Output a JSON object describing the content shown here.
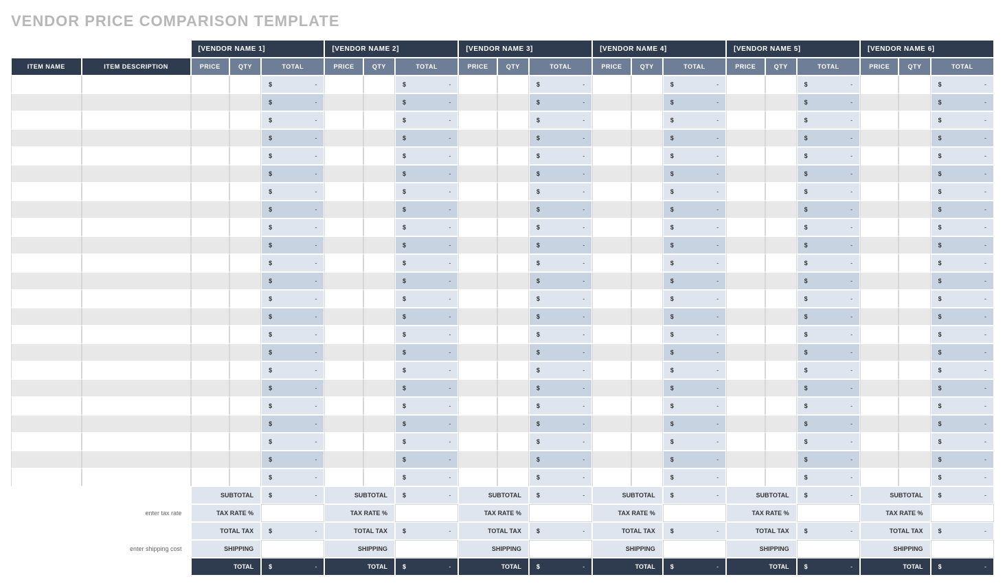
{
  "title": "VENDOR PRICE COMPARISON TEMPLATE",
  "headers": {
    "item_name": "ITEM NAME",
    "item_description": "ITEM DESCRIPTION",
    "price": "PRICE",
    "qty": "QTY",
    "total": "TOTAL"
  },
  "vendors": [
    "[VENDOR NAME 1]",
    "[VENDOR NAME 2]",
    "[VENDOR NAME 3]",
    "[VENDOR NAME 4]",
    "[VENDOR NAME 5]",
    "[VENDOR NAME 6]"
  ],
  "row_count": 23,
  "cell_currency": "$",
  "cell_dash": "-",
  "summary": {
    "subtotal_label": "SUBTOTAL",
    "tax_rate_hint": "enter tax rate",
    "tax_rate_label": "TAX RATE %",
    "total_tax_label": "TOTAL TAX",
    "shipping_hint": "enter shipping cost",
    "shipping_label": "SHIPPING",
    "grand_total_label": "TOTAL"
  }
}
